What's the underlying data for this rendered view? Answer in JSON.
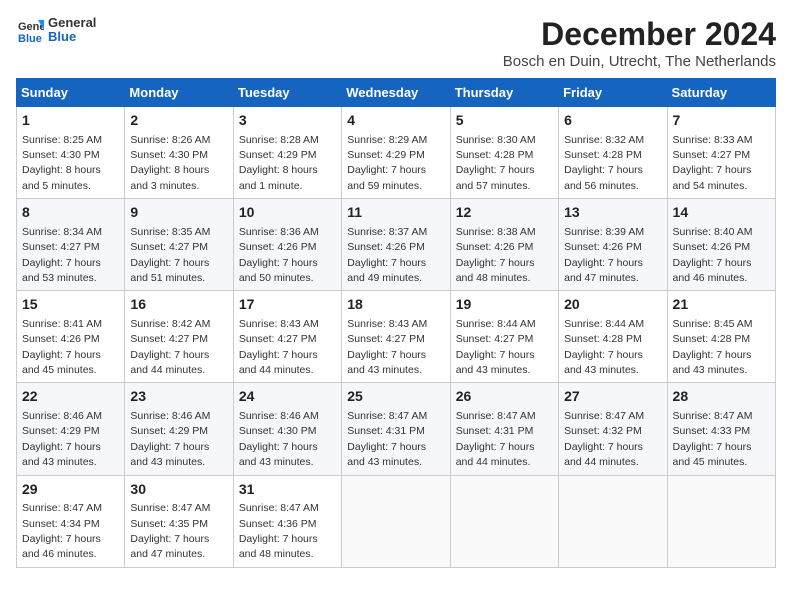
{
  "header": {
    "logo_line1": "General",
    "logo_line2": "Blue",
    "title": "December 2024",
    "subtitle": "Bosch en Duin, Utrecht, The Netherlands"
  },
  "weekdays": [
    "Sunday",
    "Monday",
    "Tuesday",
    "Wednesday",
    "Thursday",
    "Friday",
    "Saturday"
  ],
  "weeks": [
    [
      {
        "day": "1",
        "sunrise": "8:25 AM",
        "sunset": "4:30 PM",
        "daylight": "8 hours and 5 minutes."
      },
      {
        "day": "2",
        "sunrise": "8:26 AM",
        "sunset": "4:30 PM",
        "daylight": "8 hours and 3 minutes."
      },
      {
        "day": "3",
        "sunrise": "8:28 AM",
        "sunset": "4:29 PM",
        "daylight": "8 hours and 1 minute."
      },
      {
        "day": "4",
        "sunrise": "8:29 AM",
        "sunset": "4:29 PM",
        "daylight": "7 hours and 59 minutes."
      },
      {
        "day": "5",
        "sunrise": "8:30 AM",
        "sunset": "4:28 PM",
        "daylight": "7 hours and 57 minutes."
      },
      {
        "day": "6",
        "sunrise": "8:32 AM",
        "sunset": "4:28 PM",
        "daylight": "7 hours and 56 minutes."
      },
      {
        "day": "7",
        "sunrise": "8:33 AM",
        "sunset": "4:27 PM",
        "daylight": "7 hours and 54 minutes."
      }
    ],
    [
      {
        "day": "8",
        "sunrise": "8:34 AM",
        "sunset": "4:27 PM",
        "daylight": "7 hours and 53 minutes."
      },
      {
        "day": "9",
        "sunrise": "8:35 AM",
        "sunset": "4:27 PM",
        "daylight": "7 hours and 51 minutes."
      },
      {
        "day": "10",
        "sunrise": "8:36 AM",
        "sunset": "4:26 PM",
        "daylight": "7 hours and 50 minutes."
      },
      {
        "day": "11",
        "sunrise": "8:37 AM",
        "sunset": "4:26 PM",
        "daylight": "7 hours and 49 minutes."
      },
      {
        "day": "12",
        "sunrise": "8:38 AM",
        "sunset": "4:26 PM",
        "daylight": "7 hours and 48 minutes."
      },
      {
        "day": "13",
        "sunrise": "8:39 AM",
        "sunset": "4:26 PM",
        "daylight": "7 hours and 47 minutes."
      },
      {
        "day": "14",
        "sunrise": "8:40 AM",
        "sunset": "4:26 PM",
        "daylight": "7 hours and 46 minutes."
      }
    ],
    [
      {
        "day": "15",
        "sunrise": "8:41 AM",
        "sunset": "4:26 PM",
        "daylight": "7 hours and 45 minutes."
      },
      {
        "day": "16",
        "sunrise": "8:42 AM",
        "sunset": "4:27 PM",
        "daylight": "7 hours and 44 minutes."
      },
      {
        "day": "17",
        "sunrise": "8:43 AM",
        "sunset": "4:27 PM",
        "daylight": "7 hours and 44 minutes."
      },
      {
        "day": "18",
        "sunrise": "8:43 AM",
        "sunset": "4:27 PM",
        "daylight": "7 hours and 43 minutes."
      },
      {
        "day": "19",
        "sunrise": "8:44 AM",
        "sunset": "4:27 PM",
        "daylight": "7 hours and 43 minutes."
      },
      {
        "day": "20",
        "sunrise": "8:44 AM",
        "sunset": "4:28 PM",
        "daylight": "7 hours and 43 minutes."
      },
      {
        "day": "21",
        "sunrise": "8:45 AM",
        "sunset": "4:28 PM",
        "daylight": "7 hours and 43 minutes."
      }
    ],
    [
      {
        "day": "22",
        "sunrise": "8:46 AM",
        "sunset": "4:29 PM",
        "daylight": "7 hours and 43 minutes."
      },
      {
        "day": "23",
        "sunrise": "8:46 AM",
        "sunset": "4:29 PM",
        "daylight": "7 hours and 43 minutes."
      },
      {
        "day": "24",
        "sunrise": "8:46 AM",
        "sunset": "4:30 PM",
        "daylight": "7 hours and 43 minutes."
      },
      {
        "day": "25",
        "sunrise": "8:47 AM",
        "sunset": "4:31 PM",
        "daylight": "7 hours and 43 minutes."
      },
      {
        "day": "26",
        "sunrise": "8:47 AM",
        "sunset": "4:31 PM",
        "daylight": "7 hours and 44 minutes."
      },
      {
        "day": "27",
        "sunrise": "8:47 AM",
        "sunset": "4:32 PM",
        "daylight": "7 hours and 44 minutes."
      },
      {
        "day": "28",
        "sunrise": "8:47 AM",
        "sunset": "4:33 PM",
        "daylight": "7 hours and 45 minutes."
      }
    ],
    [
      {
        "day": "29",
        "sunrise": "8:47 AM",
        "sunset": "4:34 PM",
        "daylight": "7 hours and 46 minutes."
      },
      {
        "day": "30",
        "sunrise": "8:47 AM",
        "sunset": "4:35 PM",
        "daylight": "7 hours and 47 minutes."
      },
      {
        "day": "31",
        "sunrise": "8:47 AM",
        "sunset": "4:36 PM",
        "daylight": "7 hours and 48 minutes."
      },
      null,
      null,
      null,
      null
    ]
  ]
}
